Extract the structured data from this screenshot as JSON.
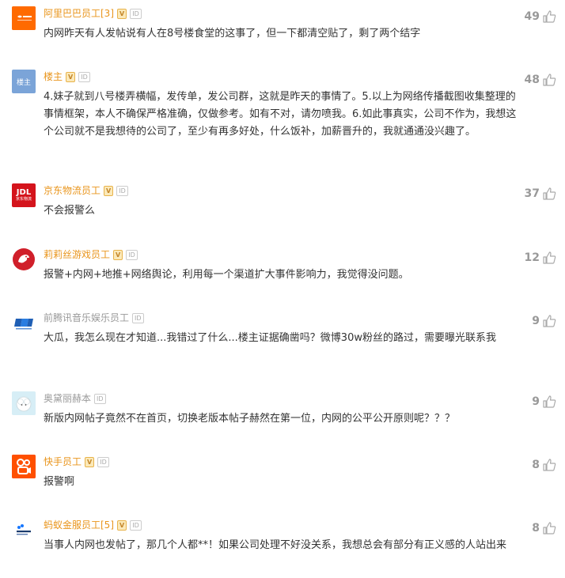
{
  "comments": [
    {
      "username": "阿里巴巴员工[3]",
      "badge_v": "V",
      "badge_id": "ID",
      "avatar": "alibaba-logo",
      "text": "内网昨天有人发帖说有人在8号楼食堂的这事了，但一下都清空贴了，剩了两个结字",
      "likes": "49"
    },
    {
      "username": "楼主",
      "badge_v": "V",
      "badge_id": "ID",
      "avatar": "louzhu-avatar",
      "avatar_text": "楼主",
      "text": "4.妹子就到八号楼弄横幅，发传单，发公司群，这就是昨天的事情了。5.以上为网络传播截图收集整理的事情框架，本人不确保严格准确，仅做参考。如有不对，请勿喷我。6.如此事真实，公司不作为，我想这个公司就不是我想待的公司了，至少有再多好处，什么饭补，加薪晋升的，我就通通没兴趣了。",
      "likes": "48"
    },
    {
      "username": "京东物流员工",
      "badge_v": "V",
      "badge_id": "ID",
      "avatar": "jdl-logo",
      "avatar_text": "JDL",
      "avatar_sub": "京东物流",
      "text": "不会报警么",
      "likes": "37"
    },
    {
      "username": "莉莉丝游戏员工",
      "badge_v": "V",
      "badge_id": "ID",
      "avatar": "lilith-logo",
      "text": "报警+内网+地推+网络舆论，利用每一个渠道扩大事件影响力，我觉得没问题。",
      "likes": "12"
    },
    {
      "username": "前腾讯音乐娱乐员工",
      "badge_v": "",
      "badge_id": "ID",
      "avatar": "tme-logo",
      "text": "大瓜，我怎么现在才知道...我错过了什么...楼主证据确凿吗？微博30w粉丝的路过，需要曝光联系我",
      "likes": "9"
    },
    {
      "username": "奥黛丽赫本",
      "badge_v": "",
      "badge_id": "ID",
      "avatar": "sheep-avatar",
      "text": "新版内网帖子竟然不在首页，切换老版本帖子赫然在第一位，内网的公平公开原则呢？？？",
      "likes": "9"
    },
    {
      "username": "快手员工",
      "badge_v": "V",
      "badge_id": "ID",
      "avatar": "kuaishou-logo",
      "text": "报警啊",
      "likes": "8"
    },
    {
      "username": "蚂蚁金服员工[5]",
      "badge_v": "V",
      "badge_id": "ID",
      "avatar": "antgroup-logo",
      "text": "当事人内网也发帖了，那几个人都**！如果公司处理不好没关系，我想总会有部分有正义感的人站出来",
      "likes": "8"
    }
  ]
}
